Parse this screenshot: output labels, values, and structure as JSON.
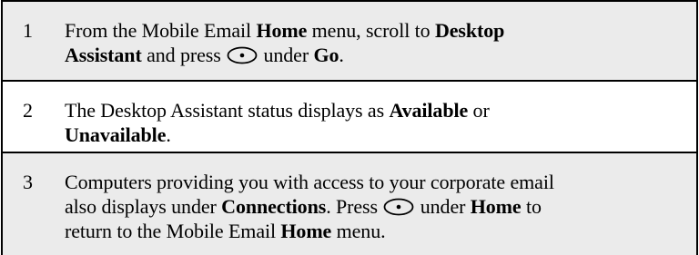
{
  "steps": [
    {
      "number": "1",
      "line1_a": "From the Mobile Email ",
      "line1_b": "Home",
      "line1_c": " menu, scroll to ",
      "line1_d": "Desktop",
      "line2_a": "Assistant",
      "line2_b": " and press ",
      "line2_c": " under ",
      "line2_d": "Go",
      "line2_e": "."
    },
    {
      "number": "2",
      "line1_a": "The Desktop Assistant status displays as ",
      "line1_b": "Available",
      "line1_c": " or",
      "line2_a": "Unavailable",
      "line2_b": "."
    },
    {
      "number": "3",
      "line1": "Computers providing you with access to your corporate email",
      "line2_a": "also displays under ",
      "line2_b": "Connections",
      "line2_c": ". Press ",
      "line2_d": " under ",
      "line2_e": "Home",
      "line2_f": " to",
      "line3_a": "return to the Mobile Email ",
      "line3_b": "Home",
      "line3_c": " menu."
    }
  ],
  "icons": {
    "softkey": "softkey-button-icon"
  }
}
